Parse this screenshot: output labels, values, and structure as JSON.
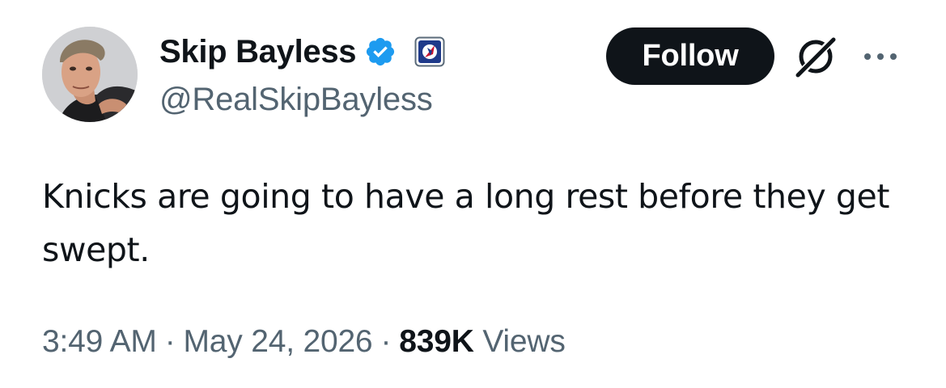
{
  "author": {
    "display_name": "Skip Bayless",
    "handle": "@RealSkipBayless",
    "verified_icon": "verified-badge-icon",
    "affiliate_icon": "affiliate-badge-icon",
    "verified_color": "#1d9bf0"
  },
  "header": {
    "follow_label": "Follow",
    "grok_icon": "grok-icon",
    "more_icon": "more-options-icon"
  },
  "tweet": {
    "text": "Knicks are going to have a long rest before they get swept."
  },
  "meta": {
    "time": "3:49 AM",
    "separator": "·",
    "date": "May 24, 2026",
    "views_count": "839K",
    "views_label": "Views"
  },
  "colors": {
    "text_primary": "#0f1419",
    "text_secondary": "#536471",
    "button_bg": "#0f1419",
    "button_text": "#ffffff"
  }
}
